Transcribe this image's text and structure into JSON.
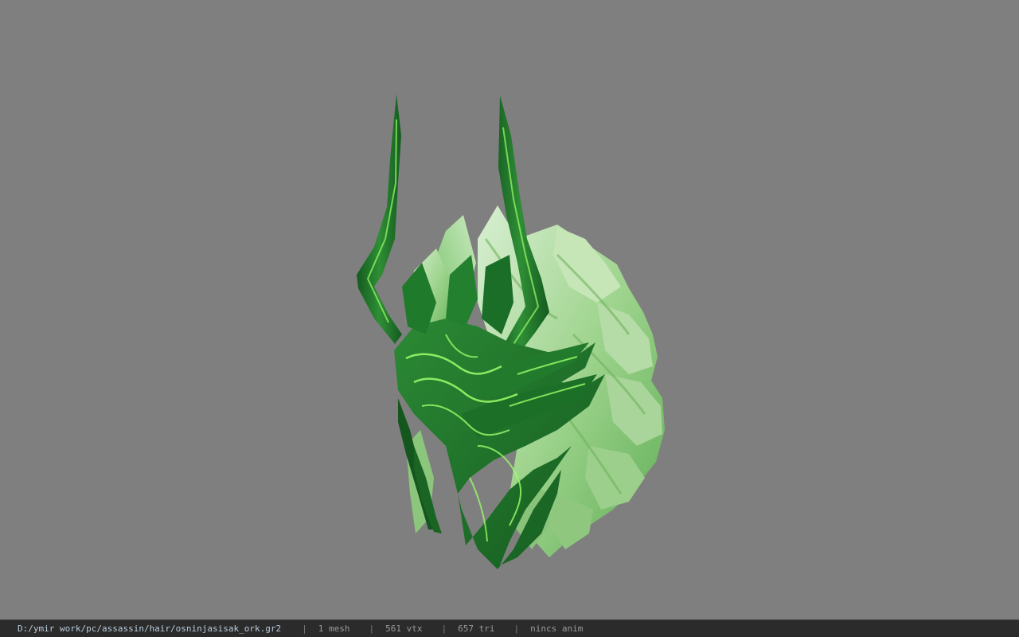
{
  "viewport": {
    "background": "#7f7f7f",
    "model_name": "osninjasisak_ork"
  },
  "status": {
    "file_path": "D:/ymir work/pc/assassin/hair/osninjasisak_ork.gr2",
    "separator": "|",
    "mesh": "1 mesh",
    "vtx": "561 vtx",
    "tri": "657 tri",
    "anim": "nincs anim"
  },
  "colors": {
    "status_bg": "#2b2b2b",
    "path_text": "#b9cbdc",
    "status_text": "#9a9a9a",
    "model_dark": "#1f6b2a",
    "model_mid": "#3f9a3f",
    "model_light": "#a8d99a",
    "model_glow": "#9cff6a"
  }
}
